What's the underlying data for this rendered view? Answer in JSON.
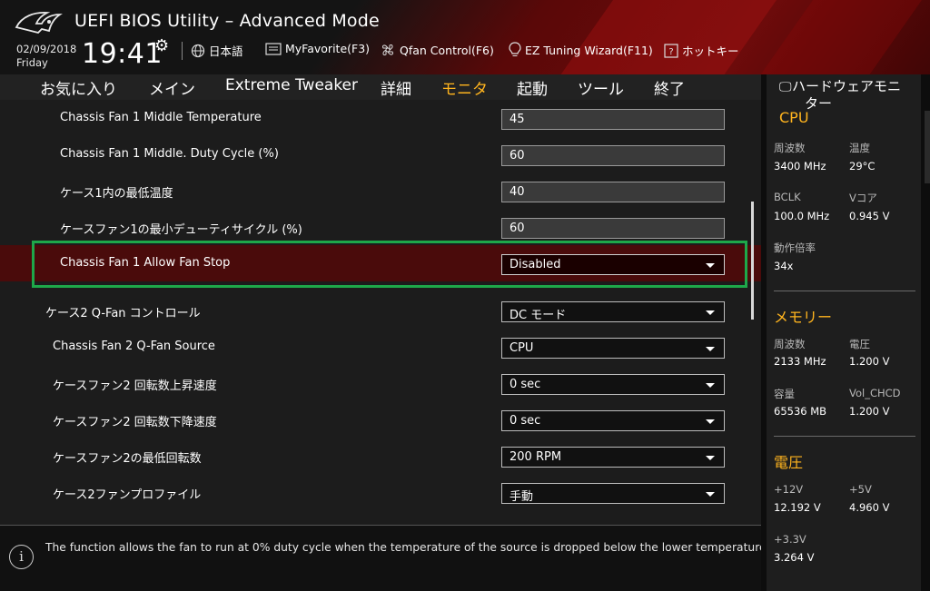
{
  "header": {
    "title": "UEFI BIOS Utility – Advanced Mode",
    "date": "02/09/2018",
    "day": "Friday",
    "time": "19:41",
    "buttons": {
      "language": "日本語",
      "myfavorite": "MyFavorite(F3)",
      "qfan": "Qfan Control(F6)",
      "ez_tuning": "EZ Tuning Wizard(F11)",
      "hotkey": "ホットキー"
    }
  },
  "menu": {
    "tabs": [
      "お気に入り",
      "メイン",
      "Extreme Tweaker",
      "詳細",
      "モニタ",
      "起動",
      "ツール",
      "終了"
    ],
    "active": "モニタ"
  },
  "settings": [
    {
      "label": "Chassis Fan 1 Middle Temperature",
      "value": "45"
    },
    {
      "label": "Chassis Fan 1 Middle. Duty Cycle (%)",
      "value": "60"
    },
    {
      "label": "ケース1内の最低温度",
      "value": "40"
    },
    {
      "label": "ケースファン1の最小デューティサイクル (%)",
      "value": "60"
    },
    {
      "label": "Chassis Fan 1 Allow Fan Stop",
      "value": "Disabled"
    },
    {
      "label": "ケース2 Q-Fan コントロール",
      "value": "DC モード"
    },
    {
      "label": "Chassis Fan 2 Q-Fan Source",
      "value": "CPU"
    },
    {
      "label": "ケースファン2 回転数上昇速度",
      "value": "0 sec"
    },
    {
      "label": "ケースファン2 回転数下降速度",
      "value": "0 sec"
    },
    {
      "label": "ケースファン2の最低回転数",
      "value": "200 RPM"
    },
    {
      "label": "ケース2ファンプロファイル",
      "value": "手動"
    }
  ],
  "help": {
    "text": "The function allows the fan to run at 0% duty cycle when the temperature of the source is dropped below the lower temperature."
  },
  "monitor": {
    "title_line1": "ハードウェアモニ",
    "title_line2": "ター",
    "cpu": {
      "title": "CPU",
      "freq_label": "周波数",
      "freq_value": "3400 MHz",
      "temp_label": "温度",
      "temp_value": "29°C",
      "bclk_label": "BCLK",
      "bclk_value": "100.0 MHz",
      "vcore_label": "Vコア",
      "vcore_value": "0.945 V",
      "ratio_label": "動作倍率",
      "ratio_value": "34x"
    },
    "memory": {
      "title": "メモリー",
      "freq_label": "周波数",
      "freq_value": "2133 MHz",
      "volt_label": "電圧",
      "volt_value": "1.200 V",
      "cap_label": "容量",
      "cap_value": "65536 MB",
      "chcd_label": "Vol_CHCD",
      "chcd_value": "1.200 V"
    },
    "voltage": {
      "title": "電圧",
      "v12_label": "+12V",
      "v12_value": "12.192 V",
      "v5_label": "+5V",
      "v5_value": "4.960 V",
      "v33_label": "+3.3V",
      "v33_value": "3.264 V"
    }
  },
  "colors": {
    "accent": "#ffb41e",
    "highlight_border": "#1ea84a",
    "selected_row": "#4a0b0b",
    "header_red": "#6e0b0b"
  }
}
